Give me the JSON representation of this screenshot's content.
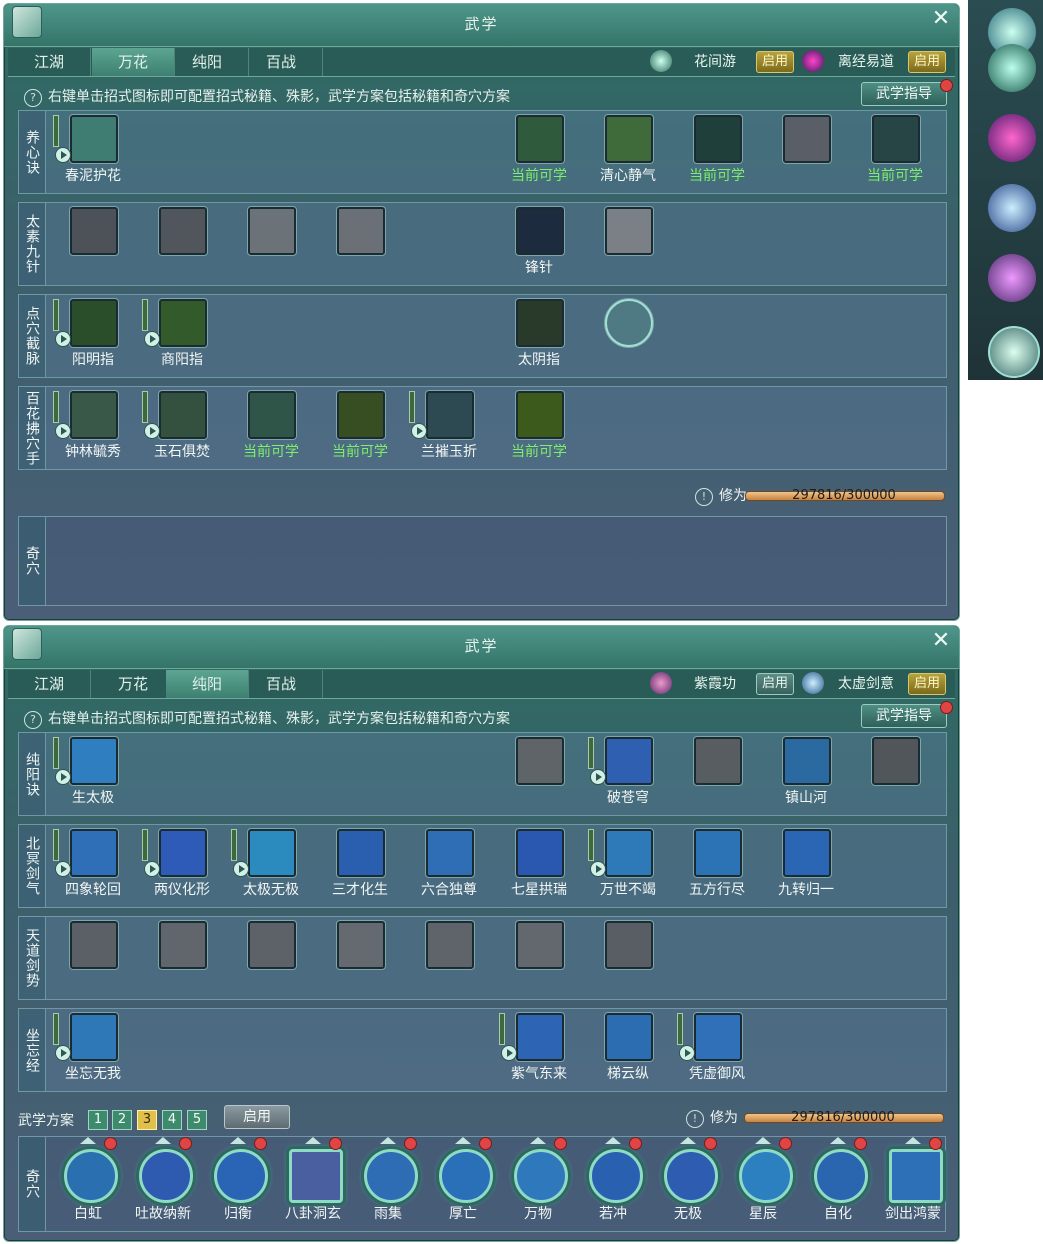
{
  "panels": [
    {
      "title": "武学",
      "tabs": [
        "江湖",
        "万花",
        "纯阳",
        "百战"
      ],
      "active_tab": 1,
      "style_slots": [
        {
          "name": "花间游",
          "button": "启用",
          "icon": "wanhua-style-icon"
        },
        {
          "name": "离经易道",
          "button": "启用",
          "icon": "lijing-style-icon"
        }
      ],
      "hint": "右键单击招式图标即可配置招式秘籍、殊影，武学方案包括秘籍和奇穴方案",
      "guide_button": "武学指导",
      "rows": [
        {
          "label": "养心诀",
          "skills": [
            {
              "name": "春泥护花",
              "learnable": false,
              "play": true,
              "bar": true,
              "color": "#3f7d73"
            },
            {
              "name": "当前可学",
              "learnable": true,
              "color": "#2f5a3c"
            },
            {
              "name": "清心静气",
              "learnable": false,
              "color": "#3f6b3a"
            },
            {
              "name": "当前可学",
              "learnable": true,
              "color": "#1f3f3a"
            },
            {
              "name": "",
              "learnable": false,
              "color": "#5a5e66"
            },
            {
              "name": "当前可学",
              "learnable": true,
              "color": "#274545"
            }
          ]
        },
        {
          "label": "太素九针",
          "skills": [
            {
              "name": "",
              "color": "#4d5258"
            },
            {
              "name": "",
              "color": "#50565c"
            },
            {
              "name": "",
              "color": "#6b7278"
            },
            {
              "name": "",
              "color": "#6a7076"
            },
            {
              "name": "锋针",
              "color": "#1c2c3e"
            },
            {
              "name": "",
              "color": "#7a8086"
            }
          ]
        },
        {
          "label": "点穴截脉",
          "skills": [
            {
              "name": "阳明指",
              "play": true,
              "bar": true,
              "color": "#2a4d2a"
            },
            {
              "name": "商阳指",
              "play": true,
              "bar": true,
              "color": "#335a2a"
            },
            {
              "name": "太阴指",
              "color": "#2a3a2a"
            },
            {
              "name": "",
              "round": true,
              "color": "#4f7a84"
            }
          ]
        },
        {
          "label": "百花拂穴手",
          "skills": [
            {
              "name": "钟林毓秀",
              "play": true,
              "bar": true,
              "color": "#3a5848"
            },
            {
              "name": "玉石俱焚",
              "play": true,
              "bar": true,
              "color": "#34503e"
            },
            {
              "name": "当前可学",
              "learnable": true,
              "color": "#2f5548"
            },
            {
              "name": "当前可学",
              "learnable": true,
              "color": "#364e22"
            },
            {
              "name": "兰摧玉折",
              "play": true,
              "bar": true,
              "color": "#2d4a52"
            },
            {
              "name": "当前可学",
              "learnable": true,
              "color": "#3b5a1c"
            }
          ]
        }
      ],
      "cultivation_label": "修为",
      "cultivation_value": "297816/300000",
      "qi_label": "奇穴"
    },
    {
      "title": "武学",
      "tabs": [
        "江湖",
        "万花",
        "纯阳",
        "百战"
      ],
      "active_tab": 2,
      "style_slots": [
        {
          "name": "紫霞功",
          "button": "启用",
          "icon": "zixia-style-icon"
        },
        {
          "name": "太虚剑意",
          "button": "启用",
          "icon": "taixu-style-icon"
        }
      ],
      "hint": "右键单击招式图标即可配置招式秘籍、殊影，武学方案包括秘籍和奇穴方案",
      "guide_button": "武学指导",
      "rows": [
        {
          "label": "纯阳诀",
          "skills": [
            {
              "name": "生太极",
              "play": true,
              "bar": true,
              "color": "#2f7fc0"
            },
            {
              "name": "",
              "color": "#5e6468"
            },
            {
              "name": "破苍穹",
              "play": true,
              "bar": true,
              "color": "#2e5fb0"
            },
            {
              "name": "",
              "color": "#585d62"
            },
            {
              "name": "镇山河",
              "color": "#2a6aa0"
            },
            {
              "name": "",
              "color": "#50565a"
            }
          ]
        },
        {
          "label": "北冥剑气",
          "skills": [
            {
              "name": "四象轮回",
              "play": true,
              "bar": true,
              "color": "#2f6fb8"
            },
            {
              "name": "两仪化形",
              "play": true,
              "bar": true,
              "color": "#2e5ab8"
            },
            {
              "name": "太极无极",
              "play": true,
              "bar": true,
              "color": "#2b8bbf"
            },
            {
              "name": "三才化生",
              "color": "#2a5fb0"
            },
            {
              "name": "六合独尊",
              "color": "#2f6db5"
            },
            {
              "name": "七星拱瑞",
              "color": "#2a58b0"
            },
            {
              "name": "万世不竭",
              "play": true,
              "bar": true,
              "color": "#2e7ab8"
            },
            {
              "name": "五方行尽",
              "color": "#2c73b6"
            },
            {
              "name": "九转归一",
              "color": "#2a66b4"
            }
          ]
        },
        {
          "label": "天道剑势",
          "skills": [
            {
              "name": "",
              "color": "#5a6066"
            },
            {
              "name": "",
              "color": "#60666c"
            },
            {
              "name": "",
              "color": "#5c6268"
            },
            {
              "name": "",
              "color": "#646a70"
            },
            {
              "name": "",
              "color": "#5e646a"
            },
            {
              "name": "",
              "color": "#62686e"
            },
            {
              "name": "",
              "color": "#585e64"
            }
          ]
        },
        {
          "label": "坐忘经",
          "skills": [
            {
              "name": "坐忘无我",
              "play": true,
              "bar": true,
              "color": "#2f78b8"
            },
            {
              "name": "紫气东来",
              "play": true,
              "bar": true,
              "color": "#2e64b4"
            },
            {
              "name": "梯云纵",
              "color": "#2c6cb0"
            },
            {
              "name": "凭虚御风",
              "play": true,
              "bar": true,
              "color": "#3070b8"
            }
          ]
        }
      ],
      "plan_label": "武学方案",
      "plans": [
        "1",
        "2",
        "3",
        "4",
        "5"
      ],
      "plan_selected": 2,
      "apply_label": "启用",
      "cultivation_label": "修为",
      "cultivation_value": "297816/300000",
      "qi_label": "奇穴",
      "qi_points": [
        "白虹",
        "吐故纳新",
        "归衡",
        "八卦洞玄",
        "雨集",
        "厚亡",
        "万物",
        "若冲",
        "无极",
        "星辰",
        "自化",
        "剑出鸿蒙"
      ]
    }
  ],
  "colors": {
    "accent": "#3d8071",
    "learnable_text": "#7cf06a",
    "enable_gold": "#b6a23c",
    "red_notice": "#e04545"
  }
}
